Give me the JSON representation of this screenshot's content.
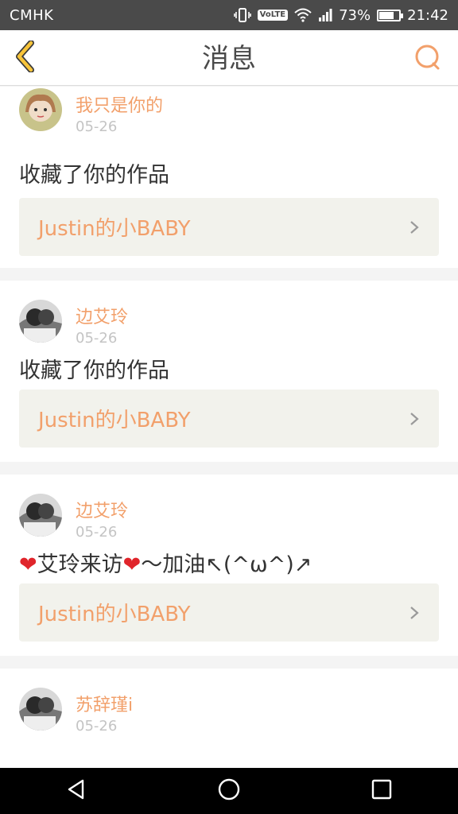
{
  "status_bar": {
    "carrier": "CMHK",
    "battery_percent": "73%",
    "battery_level": 0.73,
    "time": "21:42",
    "volte_label": "VoLTE",
    "icons": [
      "vibrate-icon",
      "volte-icon",
      "wifi-icon",
      "signal-icon",
      "battery-icon"
    ]
  },
  "header": {
    "title": "消息",
    "back_icon": "chevron-left-icon",
    "search_icon": "search-icon",
    "accent_color": "#f2a06b"
  },
  "messages": [
    {
      "username": "我只是你的",
      "date": "05-26",
      "text": "收藏了你的作品",
      "work_title": "Justin的小BABY"
    },
    {
      "username": "边艾玲",
      "date": "05-26",
      "text": "收藏了你的作品",
      "work_title": "Justin的小BABY"
    },
    {
      "username": "边艾玲",
      "date": "05-26",
      "text_heart_left": "❤",
      "text_middle": "艾玲来访",
      "text_heart_right": "❤",
      "text_tail": "～加油↖(^ω^)↗",
      "work_title": "Justin的小BABY"
    },
    {
      "username": "苏辞瑾i",
      "date": "05-26"
    }
  ],
  "nav_bar": {
    "icons": [
      "back-triangle-icon",
      "home-circle-icon",
      "recents-square-icon"
    ]
  }
}
